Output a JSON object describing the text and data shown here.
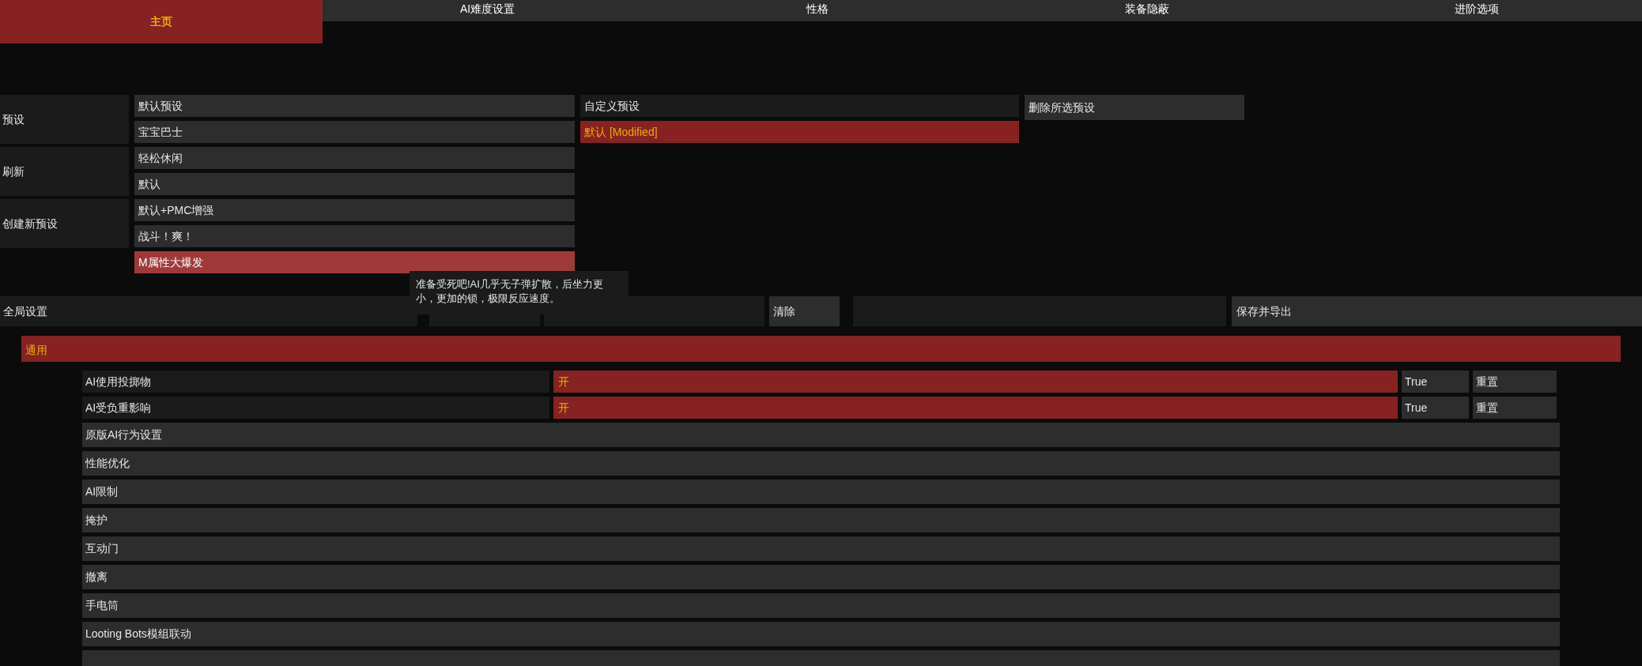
{
  "tabs": [
    {
      "label": "主页",
      "selected": true
    },
    {
      "label": "AI难度设置",
      "selected": false
    },
    {
      "label": "性格",
      "selected": false
    },
    {
      "label": "装备隐蔽",
      "selected": false
    },
    {
      "label": "进阶选项",
      "selected": false
    }
  ],
  "presets": {
    "groups": [
      {
        "label": "预设"
      },
      {
        "label": "刷新"
      },
      {
        "label": "创建新预设"
      }
    ],
    "items": [
      {
        "label": "默认预设",
        "selected": false
      },
      {
        "label": "宝宝巴士",
        "selected": false
      },
      {
        "label": "轻松休闲",
        "selected": false
      },
      {
        "label": "默认",
        "selected": false
      },
      {
        "label": "默认+PMC增强",
        "selected": false
      },
      {
        "label": "战斗！爽！",
        "selected": false
      },
      {
        "label": "M属性大爆发",
        "selected": true
      }
    ],
    "custom_header": "自定义预设",
    "custom_items": [
      {
        "label": "默认 [Modified]",
        "selected": true
      }
    ],
    "delete_button": "删除所选预设"
  },
  "tooltip": "准备受死吧!AI几乎无子弹扩散，后坐力更小，更加的锁，极限反应速度。",
  "global": {
    "label": "全局设置",
    "clear_button": "清除",
    "save_button": "保存并导出"
  },
  "section": {
    "title": "通用"
  },
  "settings": [
    {
      "kind": "toggle",
      "label": "AI使用投掷物",
      "value": "开",
      "on": true,
      "reading": "True",
      "reset": "重置"
    },
    {
      "kind": "toggle",
      "label": "AI受负重影响",
      "value": "开",
      "on": true,
      "reading": "True",
      "reset": "重置"
    },
    {
      "kind": "group",
      "label": "原版AI行为设置"
    },
    {
      "kind": "group",
      "label": "性能优化"
    },
    {
      "kind": "group",
      "label": "AI限制"
    },
    {
      "kind": "group",
      "label": "掩护"
    },
    {
      "kind": "group",
      "label": "互动门"
    },
    {
      "kind": "group",
      "label": "撤离"
    },
    {
      "kind": "group",
      "label": "手电筒"
    },
    {
      "kind": "group",
      "label": "Looting Bots模组联动"
    },
    {
      "kind": "group"
    }
  ]
}
